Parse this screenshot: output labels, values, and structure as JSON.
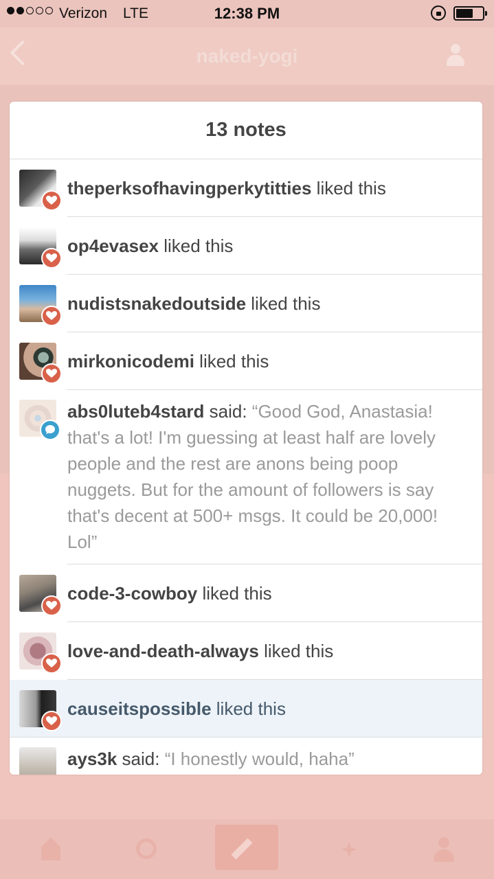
{
  "status_bar": {
    "carrier": "Verizon",
    "network": "LTE",
    "time": "12:38 PM"
  },
  "background_header": {
    "title": "naked-yogi"
  },
  "notes": {
    "title": "13 notes",
    "items": [
      {
        "type": "like",
        "user": "theperksofhavingperkytitties",
        "verb": "liked this",
        "badge_icon": "heart-icon"
      },
      {
        "type": "like",
        "user": "op4evasex",
        "verb": "liked this",
        "badge_icon": "heart-icon"
      },
      {
        "type": "like",
        "user": "nudistsnakedoutside",
        "verb": "liked this",
        "badge_icon": "heart-icon"
      },
      {
        "type": "like",
        "user": "mirkonicodemi",
        "verb": "liked this",
        "badge_icon": "heart-icon"
      },
      {
        "type": "reply",
        "user": "abs0luteb4stard",
        "verb": "said:",
        "quote": "“Good God, Anastasia! that's a lot! I'm guessing at least half are lovely people and the rest are anons being poop nuggets. But for the amount of followers is say that's decent at 500+ msgs. It could be 20,000! Lol”",
        "badge_icon": "chat-bubble-icon"
      },
      {
        "type": "like",
        "user": "code-3-cowboy",
        "verb": "liked this",
        "badge_icon": "heart-icon"
      },
      {
        "type": "like",
        "user": "love-and-death-always",
        "verb": "liked this",
        "badge_icon": "heart-icon"
      },
      {
        "type": "like",
        "user": "causeitspossible",
        "verb": "liked this",
        "badge_icon": "heart-icon",
        "highlighted": true
      },
      {
        "type": "reply",
        "user": "ays3k",
        "verb": "said:",
        "quote": "“I honestly would, haha”",
        "badge_icon": "chat-bubble-icon"
      }
    ]
  },
  "colors": {
    "like_badge": "#d9614a",
    "reply_badge": "#3aa0cf",
    "overlay_background": "#e9c3bb",
    "highlight_row": "#edf3f8"
  }
}
